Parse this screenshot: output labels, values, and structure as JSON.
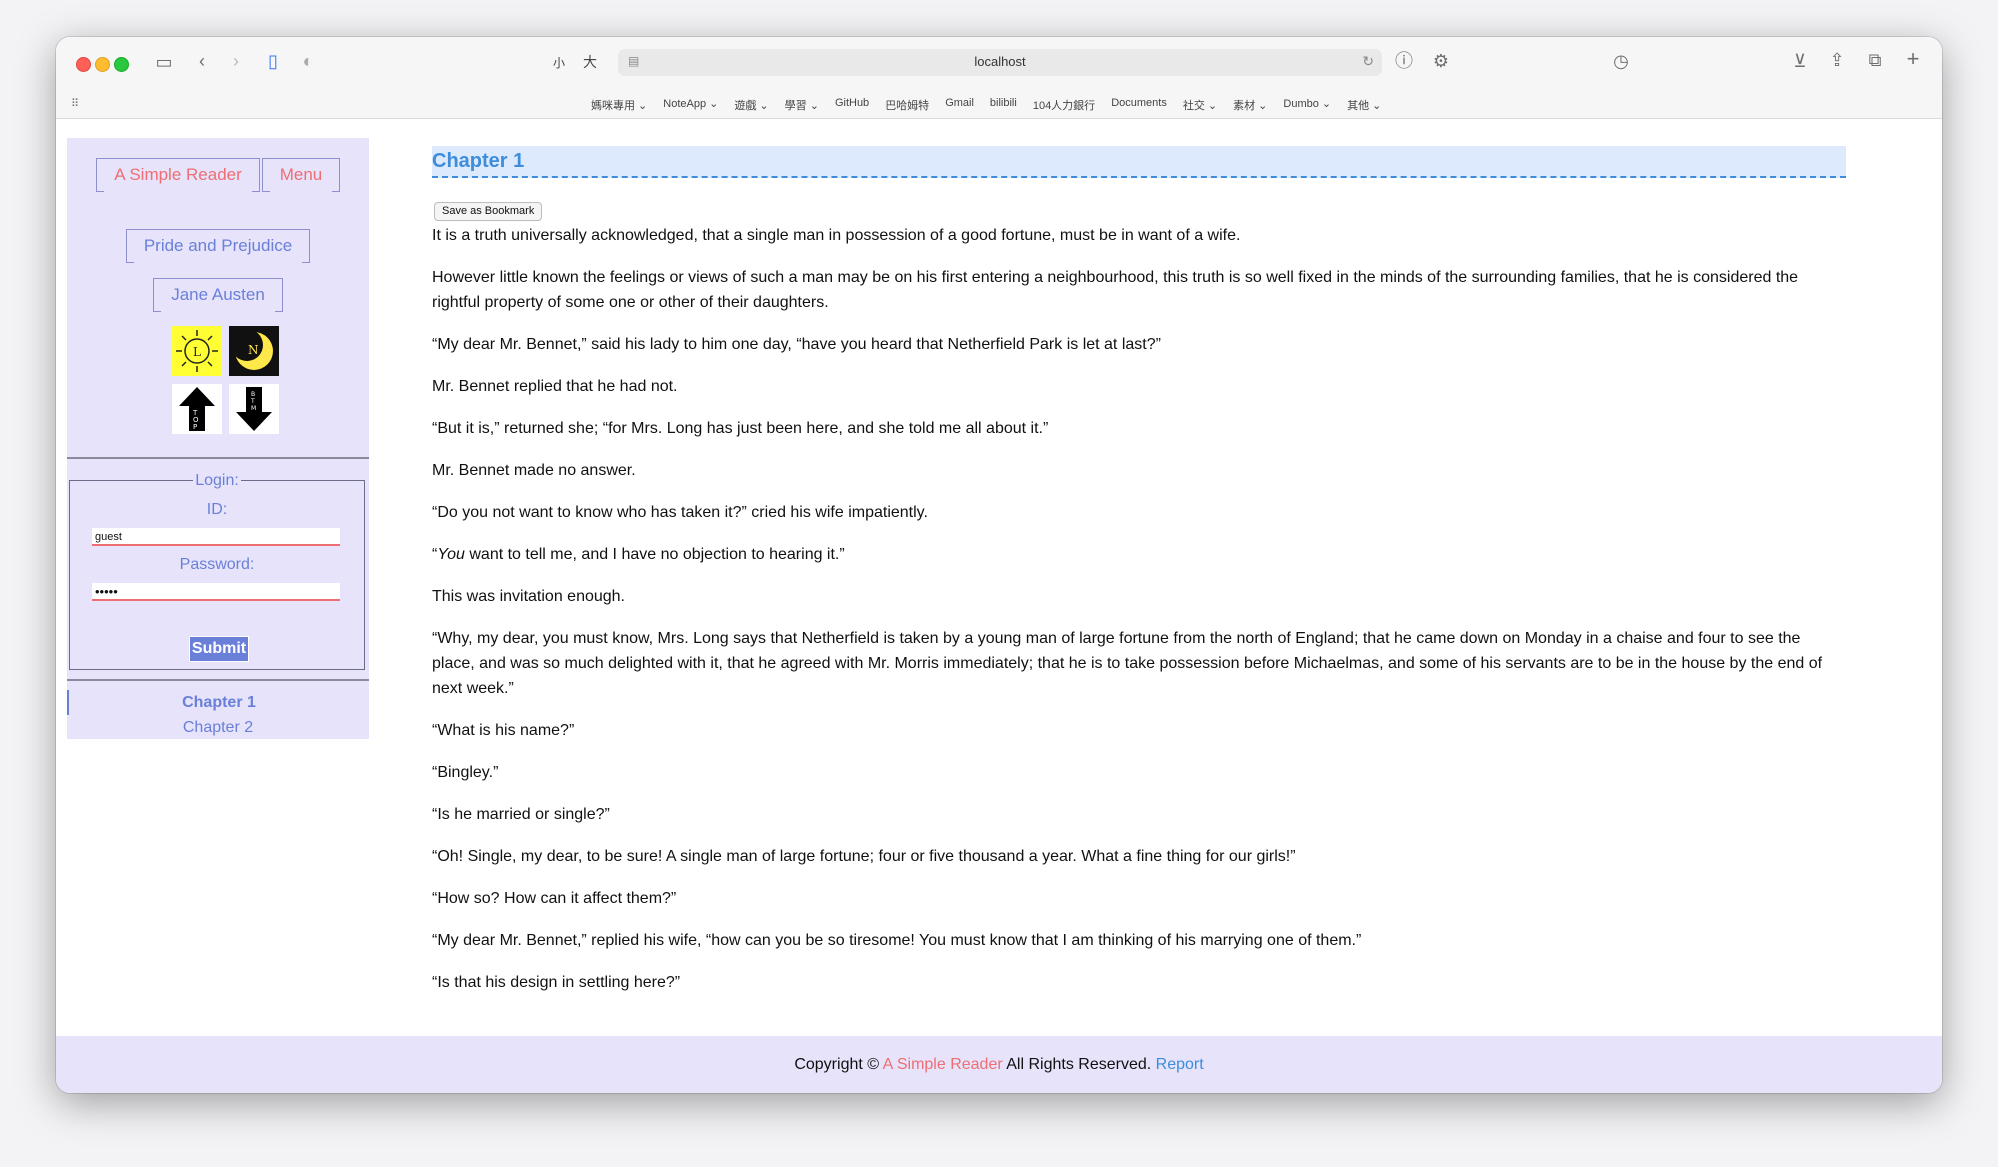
{
  "browser": {
    "url": "localhost",
    "text_size_small": "小",
    "text_size_large": "大",
    "favorites": [
      "媽咪專用 ⌄",
      "NoteApp ⌄",
      "遊戲 ⌄",
      "學習 ⌄",
      "GitHub",
      "巴哈姆特",
      "Gmail",
      "bilibili",
      "104人力銀行",
      "Documents",
      "社交 ⌄",
      "素材 ⌄",
      "Dumbo ⌄",
      "其他 ⌄"
    ]
  },
  "sidebar": {
    "site_title": "A Simple Reader",
    "menu_label": "Menu",
    "book_title": "Pride and Prejudice",
    "author": "Jane Austen",
    "login": {
      "legend": "Login:",
      "id_label": "ID:",
      "id_value": "guest",
      "password_label": "Password:",
      "password_value": "•••••",
      "submit_label": "Submit"
    },
    "chapters": [
      {
        "label": "Chapter 1",
        "active": true
      },
      {
        "label": "Chapter 2",
        "active": false
      }
    ]
  },
  "main": {
    "chapter_title": "Chapter 1",
    "bookmark_label": "Save as Bookmark",
    "paragraphs": [
      "It is a truth universally acknowledged, that a single man in possession of a good fortune, must be in want of a wife.",
      "However little known the feelings or views of such a man may be on his first entering a neighbourhood, this truth is so well fixed in the minds of the surrounding families, that he is considered the rightful property of some one or other of their daughters.",
      "“My dear Mr. Bennet,” said his lady to him one day, “have you heard that Netherfield Park is let at last?”",
      "Mr. Bennet replied that he had not.",
      "“But it is,” returned she; “for Mrs. Long has just been here, and she told me all about it.”",
      "Mr. Bennet made no answer.",
      "“Do you not want to know who has taken it?” cried his wife impatiently.",
      "“You want to tell me, and I have no objection to hearing it.”",
      "This was invitation enough.",
      "“Why, my dear, you must know, Mrs. Long says that Netherfield is taken by a young man of large fortune from the north of England; that he came down on Monday in a chaise and four to see the place, and was so much delighted with it, that he agreed with Mr. Morris immediately; that he is to take possession before Michaelmas, and some of his servants are to be in the house by the end of next week.”",
      "“What is his name?”",
      "“Bingley.”",
      "“Is he married or single?”",
      "“Oh! Single, my dear, to be sure! A single man of large fortune; four or five thousand a year. What a fine thing for our girls!”",
      "“How so? How can it affect them?”",
      "“My dear Mr. Bennet,” replied his wife, “how can you be so tiresome! You must know that I am thinking of his marrying one of them.”",
      "“Is that his design in settling here?”"
    ]
  },
  "footer": {
    "prefix": "Copyright ©",
    "brand": "A Simple Reader",
    "rights": "All Rights Reserved.",
    "report": "Report"
  },
  "colors": {
    "accent_blue": "#6a80d8",
    "accent_pink": "#ee6e73",
    "title_blue": "#3d8ddb",
    "sidebar_bg": "#e6e3fb"
  }
}
